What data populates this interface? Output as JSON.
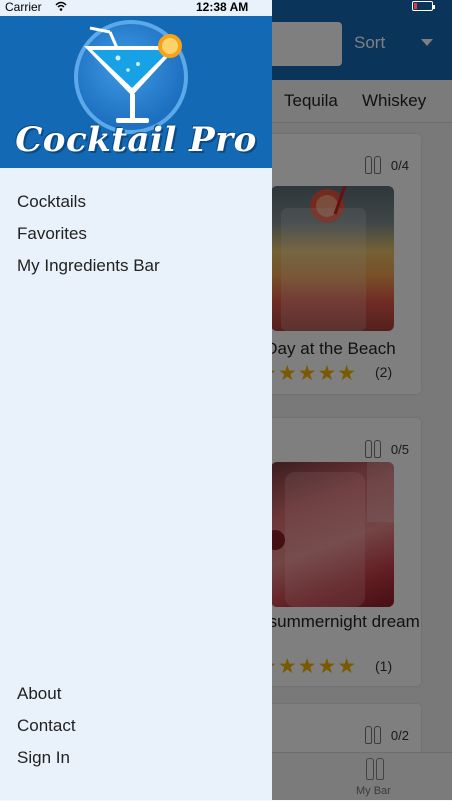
{
  "status_bar": {
    "carrier": "Carrier",
    "time": "12:38 AM"
  },
  "background_app": {
    "sort_label": "Sort",
    "category_tabs": [
      "Tequila",
      "Whiskey"
    ],
    "cards": [
      {
        "ingredients": "0/4",
        "title": "Day at the Beach",
        "rating_count": "(2)",
        "stars": 5
      },
      {
        "ingredients": "0/5",
        "title": "midsummernight dream",
        "rating_count": "(1)",
        "stars": 5
      },
      {
        "ingredients": "0/2"
      }
    ],
    "tabbar": {
      "my_bar_label": "My Bar"
    }
  },
  "drawer": {
    "logo_text": "Cocktail Pro",
    "menu_top": [
      "Cocktails",
      "Favorites",
      "My Ingredients Bar"
    ],
    "menu_bottom": [
      "About",
      "Contact",
      "Sign In"
    ]
  },
  "colors": {
    "brand_blue": "#1469b5",
    "drawer_bg": "#e9f1fa",
    "star": "#f4b400",
    "battery_low": "#e53935"
  },
  "icons": [
    "wifi-icon",
    "battery-icon",
    "cocktail-glass-logo-icon",
    "bottles-icon",
    "star-icon",
    "chevron-down-icon"
  ]
}
